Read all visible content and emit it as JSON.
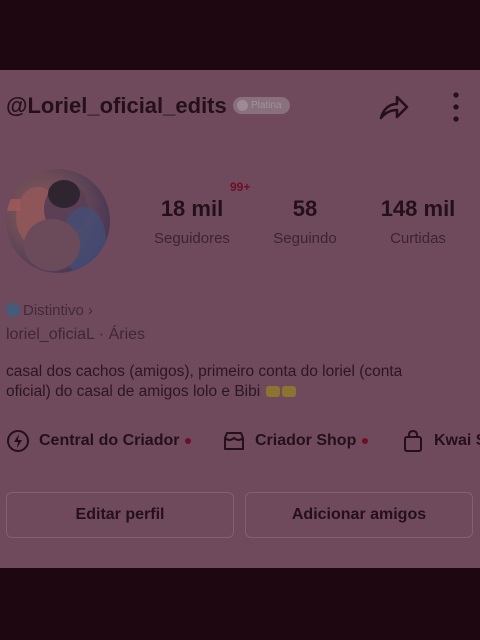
{
  "profile": {
    "username": "@Loriel_oficial_edits",
    "badge_label": "Platina",
    "distintivo_label": "Distintivo ›",
    "handle_line": "loriel_oficiaL · Áries",
    "bio": "casal dos cachos (amigos), primeiro conta do loriel (conta oficial) do casal de amigos lolo e Bibi"
  },
  "stats": [
    {
      "value": "18 mil",
      "label": "Seguidores"
    },
    {
      "value": "58",
      "label": "Seguindo"
    },
    {
      "value": "148 mil",
      "label": "Curtidas"
    }
  ],
  "notification_badge": "99+",
  "links": [
    {
      "label": "Central do Criador",
      "icon": "lightning-icon",
      "dot": true
    },
    {
      "label": "Criador Shop",
      "icon": "shop-icon",
      "dot": true
    },
    {
      "label": "Kwai S",
      "icon": "bag-icon",
      "dot": false
    }
  ],
  "buttons": {
    "edit": "Editar perfil",
    "add_friends": "Adicionar amigos"
  },
  "colors": {
    "overlay_bg": "#1f0711",
    "card_bg": "#6f4a5c",
    "text_dark": "#241019",
    "notif_red": "#6e0d26"
  }
}
